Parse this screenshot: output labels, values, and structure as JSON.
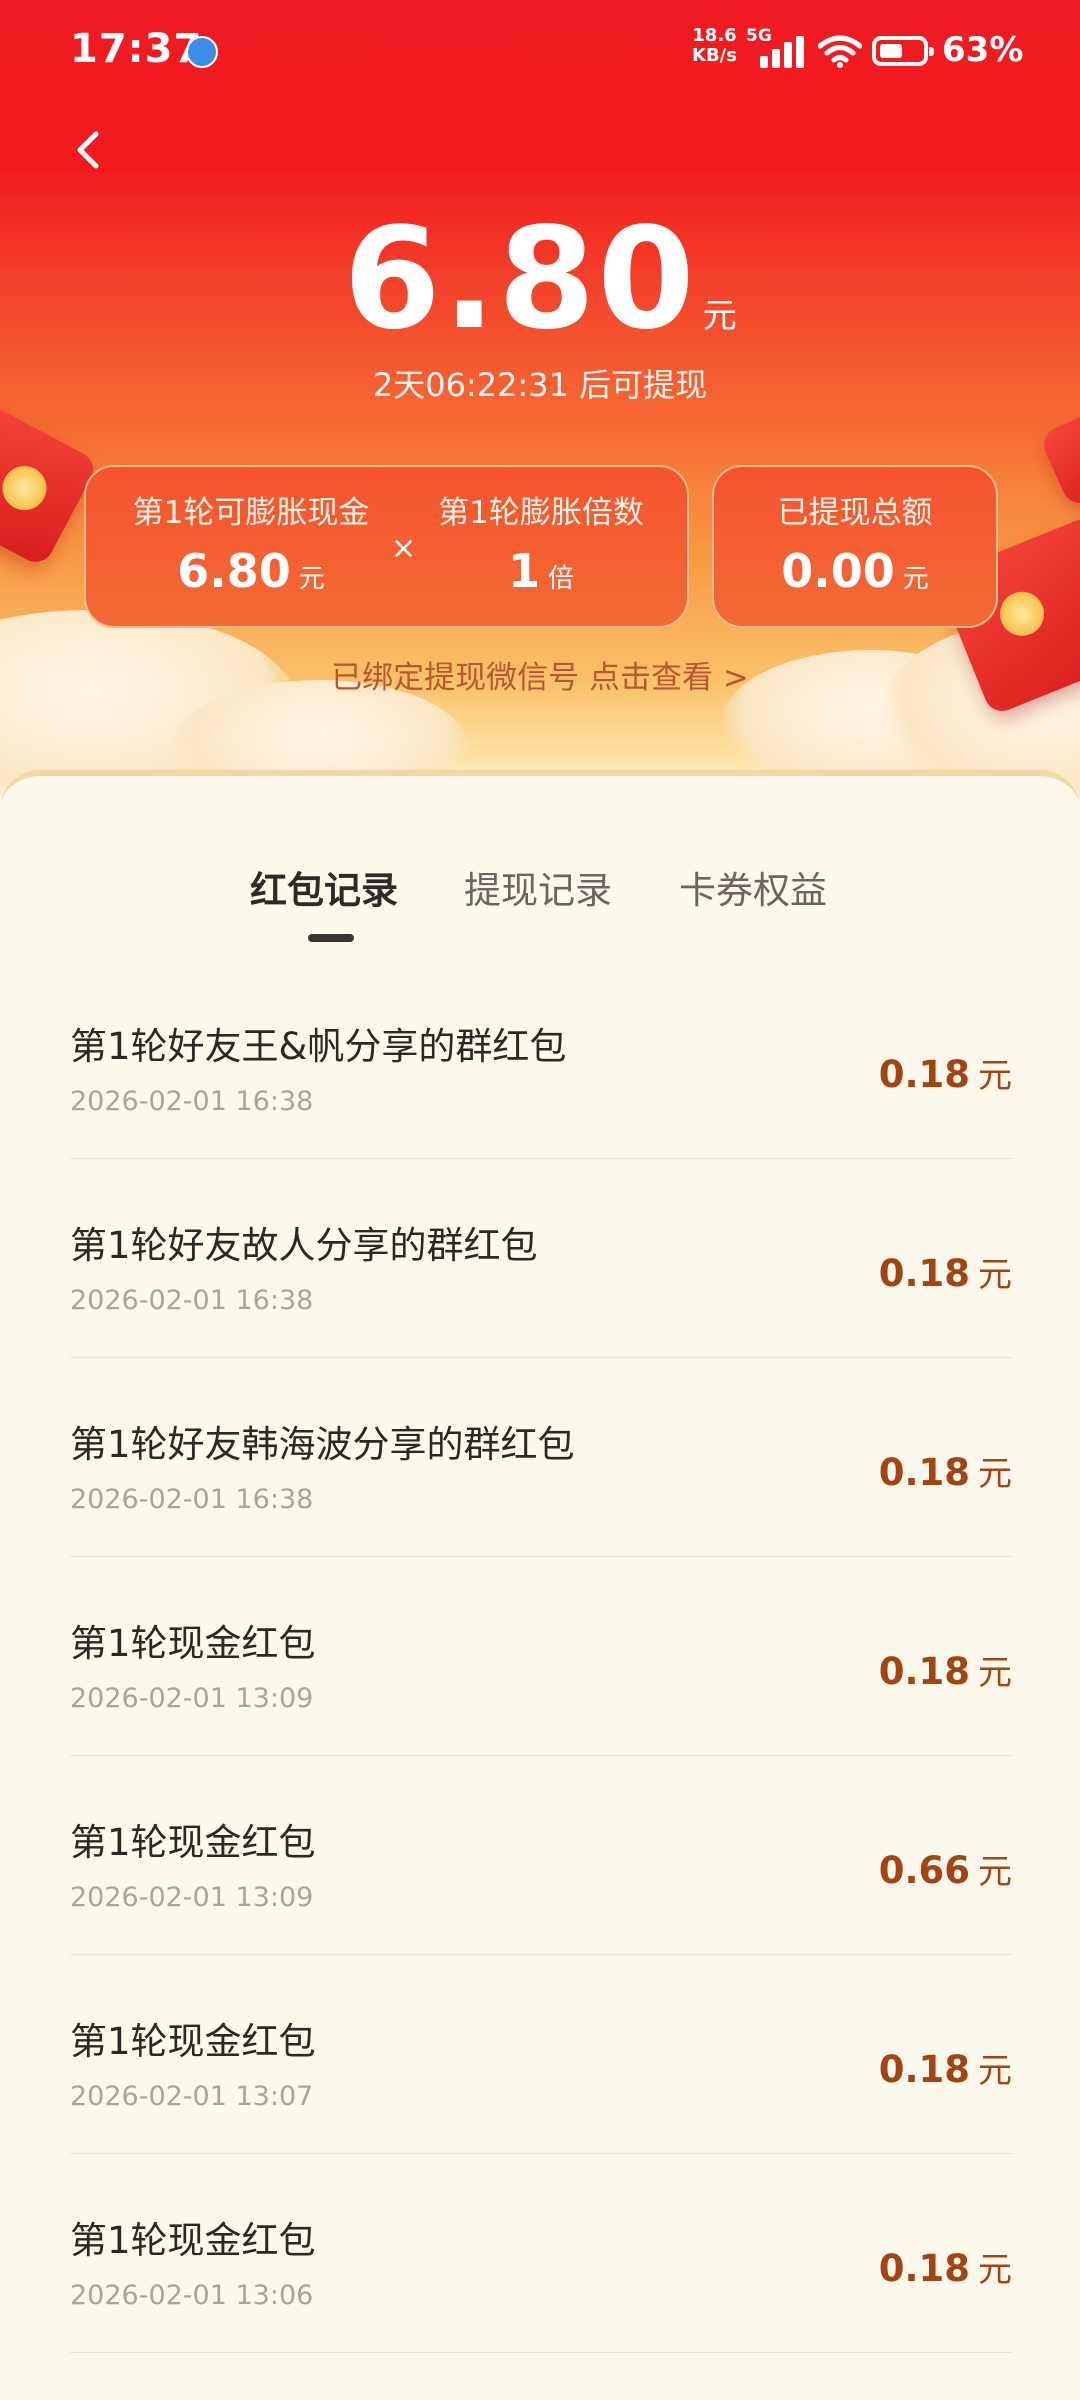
{
  "status_bar": {
    "time": "17:37",
    "net_speed_value": "18.6",
    "net_speed_unit": "KB/s",
    "network_type": "5G",
    "battery_percent": "63%",
    "battery_level": 0.63
  },
  "header": {
    "amount": "6.80",
    "amount_unit": "元",
    "countdown": "2天06:22:31 后可提现"
  },
  "stats": {
    "inflatable_label": "第1轮可膨胀现金",
    "inflatable_value": "6.80",
    "inflatable_unit": "元",
    "times_sign": "×",
    "multiplier_label": "第1轮膨胀倍数",
    "multiplier_value": "1",
    "multiplier_unit": "倍",
    "withdrawn_label": "已提现总额",
    "withdrawn_value": "0.00",
    "withdrawn_unit": "元"
  },
  "bound_link": "已绑定提现微信号 点击查看 >",
  "tabs": [
    {
      "label": "红包记录",
      "active": true
    },
    {
      "label": "提现记录",
      "active": false
    },
    {
      "label": "卡券权益",
      "active": false
    }
  ],
  "records": [
    {
      "title": "第1轮好友王&帆分享的群红包",
      "time": "2026-02-01 16:38",
      "amount": "0.18",
      "unit": "元"
    },
    {
      "title": "第1轮好友故人分享的群红包",
      "time": "2026-02-01 16:38",
      "amount": "0.18",
      "unit": "元"
    },
    {
      "title": "第1轮好友韩海波分享的群红包",
      "time": "2026-02-01 16:38",
      "amount": "0.18",
      "unit": "元"
    },
    {
      "title": "第1轮现金红包",
      "time": "2026-02-01 13:09",
      "amount": "0.18",
      "unit": "元"
    },
    {
      "title": "第1轮现金红包",
      "time": "2026-02-01 13:09",
      "amount": "0.66",
      "unit": "元"
    },
    {
      "title": "第1轮现金红包",
      "time": "2026-02-01 13:07",
      "amount": "0.18",
      "unit": "元"
    },
    {
      "title": "第1轮现金红包",
      "time": "2026-02-01 13:06",
      "amount": "0.18",
      "unit": "元"
    }
  ],
  "colors": {
    "brand_red": "#f01a22",
    "amount_brown": "#a34414",
    "page_background": "#fdf8ec"
  },
  "icons": {
    "back": "back-arrow-icon",
    "wifi": "wifi-icon",
    "signal": "signal-icon",
    "battery": "battery-icon",
    "app_notification": "app-notification-icon"
  }
}
